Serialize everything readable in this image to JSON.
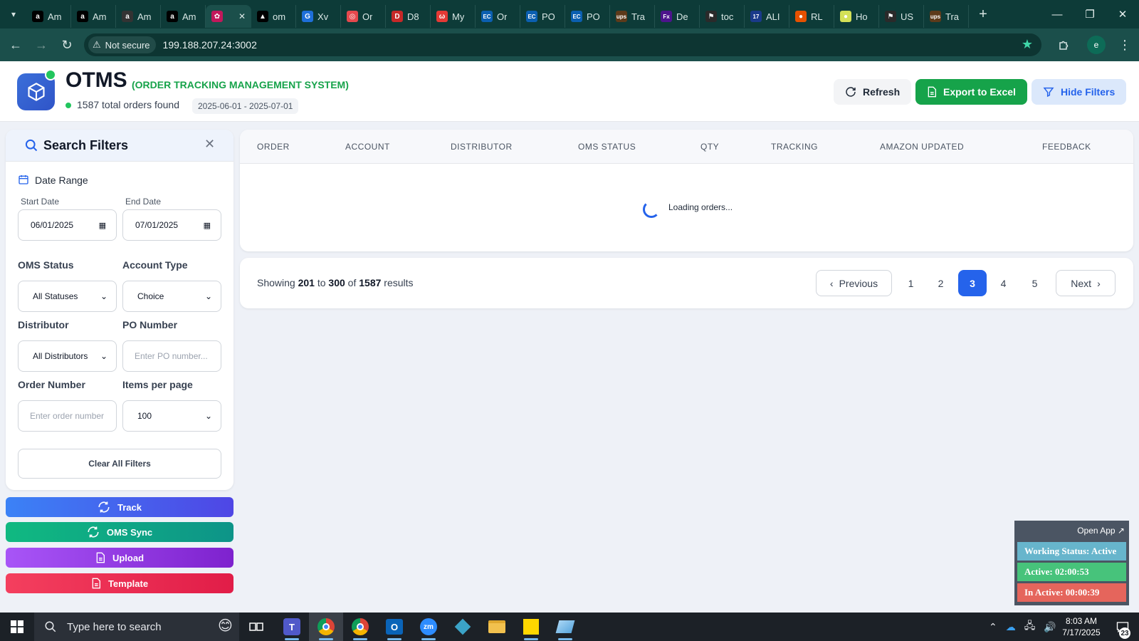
{
  "browser": {
    "tabs": [
      {
        "label": "Am",
        "favicon": "amazon-icon",
        "color": "#000000",
        "glyph": "a"
      },
      {
        "label": "Am",
        "favicon": "amazon-icon",
        "color": "#000000",
        "glyph": "a"
      },
      {
        "label": "Am",
        "favicon": "amazon-icon",
        "color": "#333333",
        "glyph": "a"
      },
      {
        "label": "Am",
        "favicon": "amazon-icon",
        "color": "#000000",
        "glyph": "a"
      },
      {
        "label": "",
        "favicon": "otms-icon",
        "color": "#c2185b",
        "glyph": "✿",
        "active": true
      },
      {
        "label": "om",
        "favicon": "triangle-icon",
        "color": "#000000",
        "glyph": "▲"
      },
      {
        "label": "Xv",
        "favicon": "xv-icon",
        "color": "#1e6fd9",
        "glyph": "G"
      },
      {
        "label": "Or",
        "favicon": "orders-icon",
        "color": "#e5484d",
        "glyph": "◎"
      },
      {
        "label": "D8",
        "favicon": "dh-icon",
        "color": "#c62828",
        "glyph": "D"
      },
      {
        "label": "My",
        "favicon": "my-icon",
        "color": "#e53935",
        "glyph": "ω"
      },
      {
        "label": "Or",
        "favicon": "ec-icon",
        "color": "#0b5fb0",
        "glyph": "EC"
      },
      {
        "label": "PO",
        "favicon": "ec-icon",
        "color": "#0b5fb0",
        "glyph": "EC"
      },
      {
        "label": "PO",
        "favicon": "ec-icon",
        "color": "#0b5fb0",
        "glyph": "EC"
      },
      {
        "label": "Tra",
        "favicon": "ups-icon",
        "color": "#5d3a1a",
        "glyph": "ups"
      },
      {
        "label": "De",
        "favicon": "fedex-icon",
        "color": "#4d148c",
        "glyph": "Fx"
      },
      {
        "label": "toc",
        "favicon": "flag-icon",
        "color": "#2a2a2a",
        "glyph": "⚑"
      },
      {
        "label": "ALI",
        "favicon": "17track-icon",
        "color": "#1a3a8a",
        "glyph": "17"
      },
      {
        "label": "RL",
        "favicon": "rl-icon",
        "color": "#e65100",
        "glyph": "●"
      },
      {
        "label": "Ho",
        "favicon": "ho-icon",
        "color": "#d4e157",
        "glyph": "●"
      },
      {
        "label": "US",
        "favicon": "usps-icon",
        "color": "#2a2a2a",
        "glyph": "⚑"
      },
      {
        "label": "Tra",
        "favicon": "ups-icon",
        "color": "#5d3a1a",
        "glyph": "ups"
      }
    ],
    "security_label": "Not secure",
    "url": "199.188.207.24:3002",
    "profile_initial": "e"
  },
  "header": {
    "title": "OTMS",
    "subtitle": "(ORDER TRACKING MANAGEMENT SYSTEM)",
    "orders_found": "1587 total orders found",
    "date_range": "2025-06-01 - 2025-07-01",
    "refresh_label": "Refresh",
    "export_label": "Export to Excel",
    "hide_filters_label": "Hide Filters"
  },
  "filters": {
    "title": "Search Filters",
    "date_range_title": "Date Range",
    "start_date_label": "Start Date",
    "start_date_value": "06/01/2025",
    "end_date_label": "End Date",
    "end_date_value": "07/01/2025",
    "oms_status_label": "OMS Status",
    "oms_status_value": "All Statuses",
    "account_type_label": "Account Type",
    "account_type_value": "Choice",
    "distributor_label": "Distributor",
    "distributor_value": "All Distributors",
    "po_number_label": "PO Number",
    "po_number_placeholder": "Enter PO number...",
    "order_number_label": "Order Number",
    "order_number_placeholder": "Enter order number",
    "items_per_page_label": "Items per page",
    "items_per_page_value": "100",
    "clear_label": "Clear All Filters"
  },
  "actions": {
    "track": "Track",
    "oms_sync": "OMS Sync",
    "upload": "Upload",
    "template": "Template"
  },
  "table": {
    "columns": [
      "ORDER",
      "ACCOUNT",
      "DISTRIBUTOR",
      "OMS STATUS",
      "QTY",
      "TRACKING",
      "AMAZON UPDATED",
      "FEEDBACK"
    ],
    "loading_text": "Loading orders..."
  },
  "pagination": {
    "showing_prefix": "Showing",
    "from": "201",
    "to_word": "to",
    "to": "300",
    "of_word": "of",
    "total": "1587",
    "results_word": "results",
    "previous_label": "Previous",
    "pages": [
      "1",
      "2",
      "3",
      "4",
      "5"
    ],
    "current_page": "3",
    "next_label": "Next"
  },
  "widget": {
    "open_app": "Open App ↗",
    "working_status": "Working Status: Active",
    "active_time": "Active: 02:00:53",
    "inactive_time": "In Active: 00:00:39"
  },
  "taskbar": {
    "search_placeholder": "Type here to search",
    "time": "8:03 AM",
    "date": "7/17/2025",
    "notification_count": "23"
  },
  "colors": {
    "primary": "#2563eb",
    "success": "#16a34a",
    "accent_green": "#22c55e"
  }
}
